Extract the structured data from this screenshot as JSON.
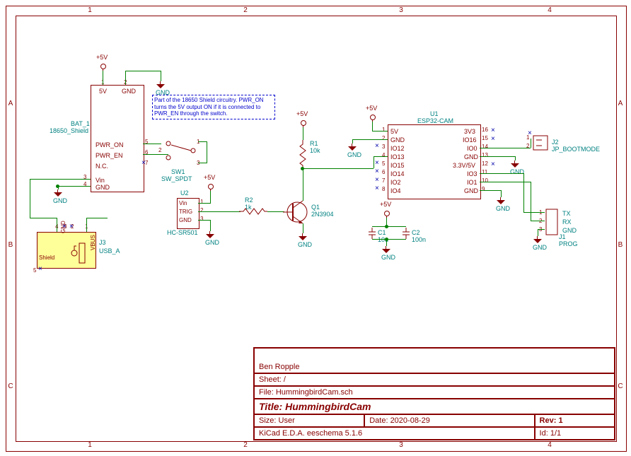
{
  "ruler": {
    "top": [
      "1",
      "2",
      "3",
      "4"
    ],
    "left": [
      "A",
      "B",
      "C"
    ]
  },
  "power": {
    "p5v": "+5V"
  },
  "ground": "GND",
  "bat": {
    "ref": "BAT_1",
    "val": "18650_Shield",
    "pins": {
      "p1": "5V",
      "p2": "GND",
      "p5": "PWR_ON",
      "p6": "PWR_EN",
      "p7": "N.C.",
      "p3": "Vin",
      "p4": "GND"
    }
  },
  "sw": {
    "ref": "SW1",
    "val": "SW_SPDT"
  },
  "note": "Part of the 18650 Shield circuitry. PWR_ON turns the 5V output ON if it is connected to PWR_EN through the switch.",
  "u2": {
    "ref": "U2",
    "val": "HC-SR501",
    "p1": "Vin",
    "p2": "TRIG",
    "p3": "GND"
  },
  "r1": {
    "ref": "R1",
    "val": "10k"
  },
  "r2": {
    "ref": "R2",
    "val": "1k"
  },
  "q1": {
    "ref": "Q1",
    "val": "2N3904"
  },
  "c1": {
    "ref": "C1",
    "val": "10u"
  },
  "c2": {
    "ref": "C2",
    "val": "100n"
  },
  "u1": {
    "ref": "U1",
    "val": "ESP32-CAM",
    "left": [
      "5V",
      "GND",
      "IO12",
      "IO13",
      "IO15",
      "IO14",
      "IO2",
      "IO4"
    ],
    "right": [
      "3V3",
      "IO16",
      "IO0",
      "GND",
      "3.3V/5V",
      "IO3",
      "IO1",
      "GND"
    ],
    "lnums": [
      "1",
      "2",
      "3",
      "4",
      "5",
      "6",
      "7",
      "8"
    ],
    "rnums": [
      "16",
      "15",
      "14",
      "13",
      "12",
      "11",
      "10",
      "9"
    ]
  },
  "j2": {
    "ref": "J2",
    "val": "JP_BOOTMODE"
  },
  "j1": {
    "ref": "J1",
    "val": "PROG",
    "p1": "TX",
    "p2": "RX",
    "p3": "GND"
  },
  "j3": {
    "ref": "J3",
    "val": "USB_A",
    "shield": "Shield",
    "gnd": "GND",
    "vbus": "VBUS",
    "dplus": "D+",
    "dminus": "D-"
  },
  "titleblock": {
    "author": "Ben Ropple",
    "sheet_label": "Sheet:",
    "sheet": "/",
    "file_label": "File:",
    "file": "HummingbirdCam.sch",
    "title_label": "Title:",
    "title": "HummingbirdCam",
    "size_label": "Size:",
    "size": "User",
    "date_label": "Date:",
    "date": "2020-08-29",
    "rev_label": "Rev:",
    "rev": "1",
    "app": "KiCad E.D.A.  eeschema 5.1.6",
    "id_label": "Id:",
    "id": "1/1"
  }
}
